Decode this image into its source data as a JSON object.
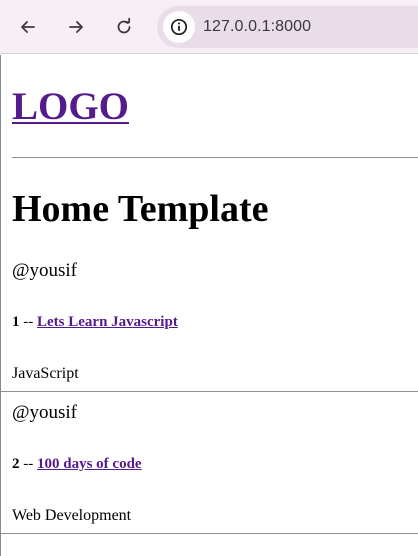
{
  "browser": {
    "url": "127.0.0.1:8000"
  },
  "page": {
    "logo": "LOGO",
    "title": "Home Template",
    "posts": [
      {
        "author": "@yousif",
        "number": "1",
        "separator": " -- ",
        "title": "Lets Learn Javascript",
        "category": "JavaScript"
      },
      {
        "author": "@yousif",
        "number": "2",
        "separator": " -- ",
        "title": "100 days of code",
        "category": "Web Development"
      }
    ]
  },
  "icons": {
    "back": "arrow-left-icon",
    "forward": "arrow-right-icon",
    "reload": "reload-icon",
    "site_info": "info-icon"
  },
  "colors": {
    "link_visited": "#551a8b",
    "chrome_bg": "#f8eff6",
    "omnibox_bg": "#e8dde9"
  }
}
